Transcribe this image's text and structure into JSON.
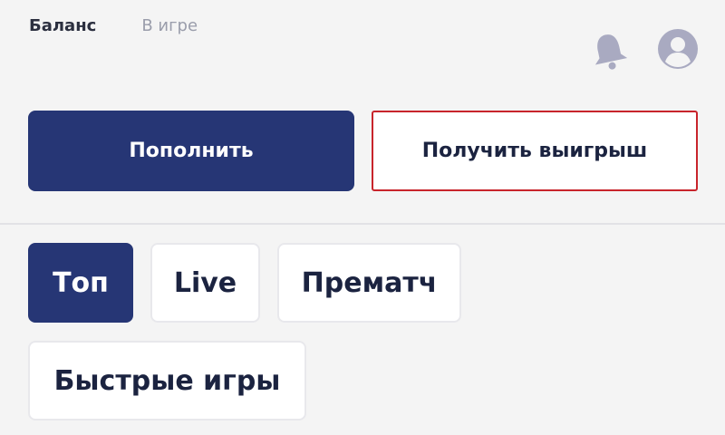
{
  "header": {
    "tabs": [
      {
        "label": "Баланс",
        "active": true
      },
      {
        "label": "В игре",
        "active": false
      }
    ],
    "icons": [
      "bell-icon",
      "user-icon"
    ]
  },
  "actions": {
    "deposit_label": "Пополнить",
    "withdraw_label": "Получить выигрыш"
  },
  "categories": [
    {
      "label": "Топ",
      "active": true
    },
    {
      "label": "Live",
      "active": false
    },
    {
      "label": "Прематч",
      "active": false
    },
    {
      "label": "Быстрые игры",
      "active": false
    }
  ],
  "colors": {
    "primary": "#263675",
    "highlight_border": "#c8242b",
    "background": "#f4f4f4",
    "icon": "#a9aac1"
  }
}
